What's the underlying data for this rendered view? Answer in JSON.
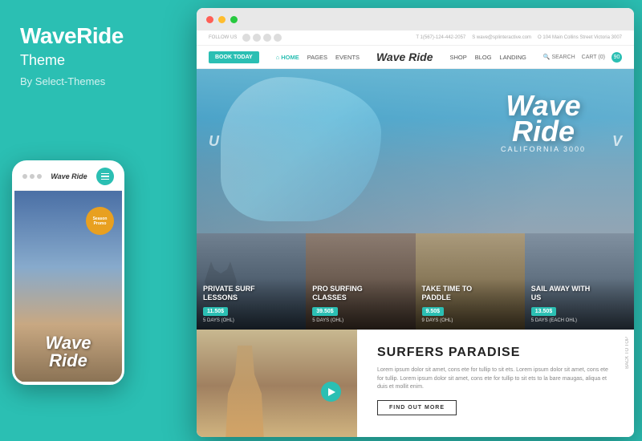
{
  "brand": {
    "title": "WaveRide",
    "subtitle": "Theme",
    "by": "By Select-Themes"
  },
  "mobile": {
    "logo": "Wave Ride",
    "season": "Season\nPromo"
  },
  "browser": {
    "topbar": {
      "follow_label": "FOLLOW US",
      "phone": "T 1(567)-124-442-2057",
      "email": "S wave@splinteractive.com",
      "address": "O 104 Main Collins Street Victoria 3007"
    },
    "nav": {
      "book_btn": "BOOK TODAY",
      "links": [
        "HOME",
        "PAGES",
        "EVENTS"
      ],
      "logo": "Wave Ride",
      "right": [
        "SEARCH",
        "CART (0)"
      ]
    },
    "hero": {
      "left_letter": "U",
      "right_letter": "V",
      "logo_main": "Wave Ride",
      "tagline": "CALIFORNIA 3000"
    },
    "cards": [
      {
        "title": "PRIVATE SURF\nLESSONS",
        "badge": "11.50$",
        "days": "5 DAYS (OHL)"
      },
      {
        "title": "PRO SURFING\nCLASSES",
        "badge": "39.50$",
        "days": "5 DAYS (OHL)"
      },
      {
        "title": "TAKE TIME TO\nPADDLE",
        "badge": "9.50$",
        "days": "9 DAYS (OHL)"
      },
      {
        "title": "SAIL AWAY WITH\nUS",
        "badge": "13.50$",
        "days": "5 DAYS (EACH OHL)"
      }
    ],
    "bottom": {
      "title": "SURFERS PARADISE",
      "text": "Lorem ipsum dolor sit amet, cons ete for tullip to sit ets. Lorem ipsum dolor sit amet, cons ete for tullip. Lorem ipsum dolor sit amet, cons ete for tullip to sit ets to la bare maugas, aliqua et duis et mollit enim.",
      "find_out_btn": "FIND OUT MORE",
      "back_to_top": "BACK TO TOP"
    }
  },
  "colors": {
    "teal": "#2bbfb3",
    "dark": "#222",
    "light": "#fff"
  }
}
